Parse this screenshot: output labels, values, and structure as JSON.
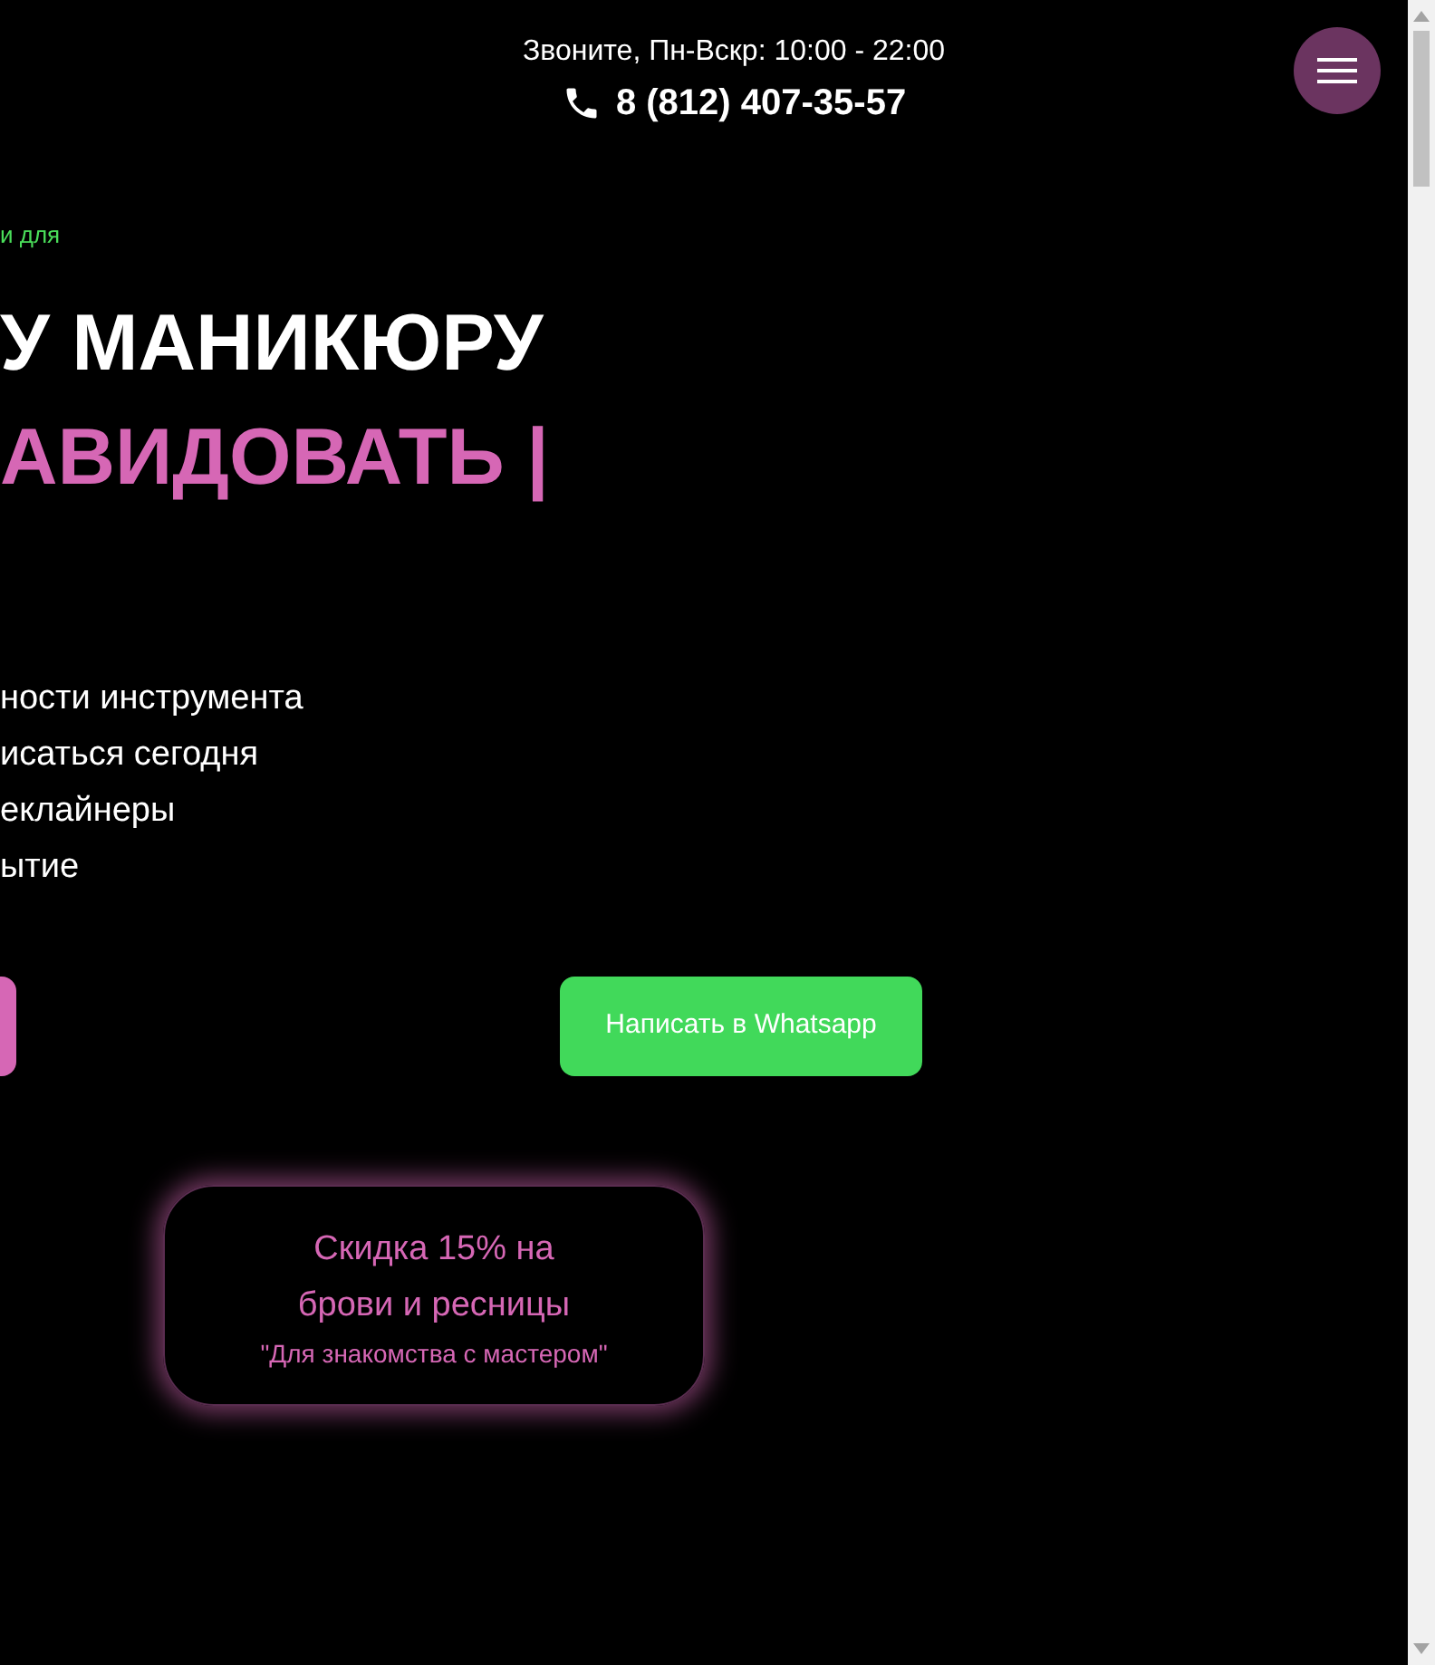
{
  "header": {
    "hours": "Звоните, Пн-Вскр: 10:00 - 22:00",
    "phone": "8 (812) 407-35-57"
  },
  "hero": {
    "kicker": "и для",
    "title_line_1": "У МАНИКЮРУ",
    "title_line_2": "АВИДОВАТЬ |",
    "bullets": [
      "ности инструмента",
      "исаться сегодня",
      "еклайнеры",
      "ытие"
    ]
  },
  "buttons": [
    {
      "kind": "cut"
    },
    {
      "kind": "whatsapp",
      "label": "Написать в Whatsapp"
    }
  ],
  "promo": {
    "title": "Скидка 15% на брови и ресницы",
    "note": "\"Для знакомства с мастером\""
  }
}
